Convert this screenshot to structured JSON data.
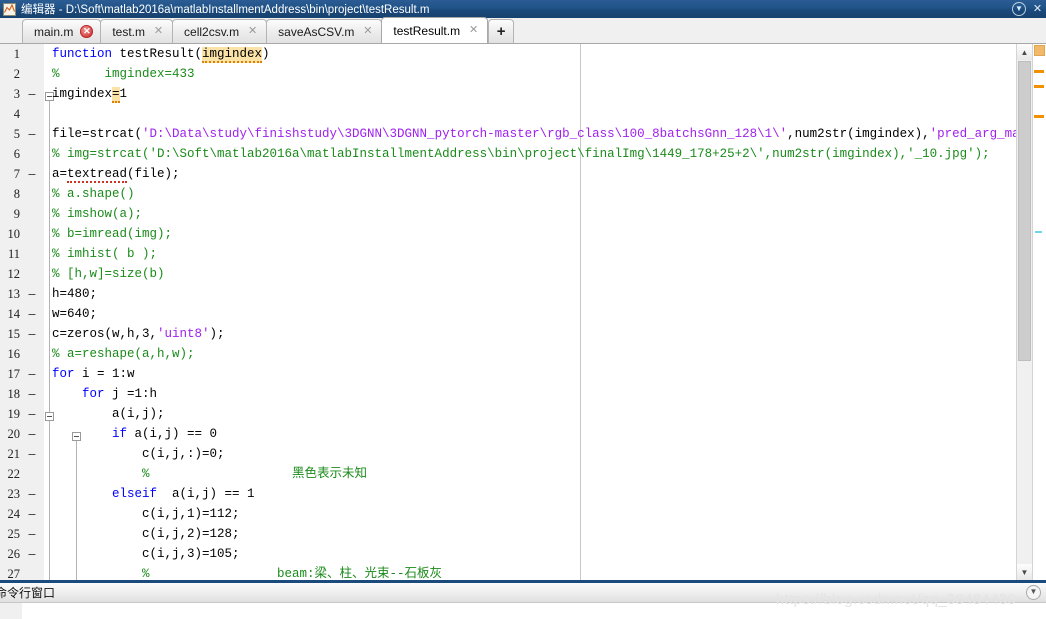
{
  "window": {
    "title": "编辑器 - D:\\Soft\\matlab2016a\\matlabInstallmentAddress\\bin\\project\\testResult.m",
    "icon": "matlab-editor-icon",
    "minimize_label": "▼",
    "close_label": "✕"
  },
  "tabs": {
    "items": [
      {
        "label": "main.m",
        "close": "✕",
        "dirty": true,
        "active": false
      },
      {
        "label": "test.m",
        "close": "✕",
        "dirty": false,
        "active": false
      },
      {
        "label": "cell2csv.m",
        "close": "✕",
        "dirty": false,
        "active": false
      },
      {
        "label": "saveAsCSV.m",
        "close": "✕",
        "dirty": false,
        "active": false
      },
      {
        "label": "testResult.m",
        "close": "✕",
        "dirty": false,
        "active": true
      }
    ],
    "add_label": "+"
  },
  "editor": {
    "lines": [
      {
        "num": "1",
        "dash": "",
        "html": "<span class=\"kw\">function</span> testResult(<span class=\"hl wavy\">imgindex</span>)"
      },
      {
        "num": "2",
        "dash": "",
        "html": "<span class=\"cmt\">%      imgindex=433</span>"
      },
      {
        "num": "3",
        "dash": "–",
        "html": "imgindex<span class=\"hl wavy\">=</span>1"
      },
      {
        "num": "4",
        "dash": "",
        "html": ""
      },
      {
        "num": "5",
        "dash": "–",
        "html": "file=strcat(<span class=\"str\">'D:\\Data\\study\\finishstudy\\3DGNN\\3DGNN_pytorch-master\\rgb_class\\100_8batchsGnn_128\\1\\'</span>,num2str(imgindex),<span class=\"str\">'pred_arg_max.txt'</span>);"
      },
      {
        "num": "6",
        "dash": "",
        "html": "<span class=\"cmt\">% img=strcat('D:\\Soft\\matlab2016a\\matlabInstallmentAddress\\bin\\project\\finalImg\\1449_178+25+2\\',num2str(imgindex),'_10.jpg');</span>"
      },
      {
        "num": "7",
        "dash": "–",
        "html": "a=<span class=\"wavy-red\">textread</span>(file);"
      },
      {
        "num": "8",
        "dash": "",
        "html": "<span class=\"cmt\">% a.shape()</span>"
      },
      {
        "num": "9",
        "dash": "",
        "html": "<span class=\"cmt\">% imshow(a);</span>"
      },
      {
        "num": "10",
        "dash": "",
        "html": "<span class=\"cmt\">% b=imread(img);</span>"
      },
      {
        "num": "11",
        "dash": "",
        "html": "<span class=\"cmt\">% imhist( b );</span>"
      },
      {
        "num": "12",
        "dash": "",
        "html": "<span class=\"cmt\">% [h,w]=size(b)</span>"
      },
      {
        "num": "13",
        "dash": "–",
        "html": "h=480;"
      },
      {
        "num": "14",
        "dash": "–",
        "html": "w=640;"
      },
      {
        "num": "15",
        "dash": "–",
        "html": "c=zeros(w,h,3,<span class=\"str\">'uint8'</span>);"
      },
      {
        "num": "16",
        "dash": "",
        "html": "<span class=\"cmt\">% a=reshape(a,h,w);</span>"
      },
      {
        "num": "17",
        "dash": "–",
        "html": "<span class=\"kw\">for</span> i = 1:w"
      },
      {
        "num": "18",
        "dash": "–",
        "html": "    <span class=\"kw\">for</span> j =1:h"
      },
      {
        "num": "19",
        "dash": "–",
        "html": "        a(i,j);"
      },
      {
        "num": "20",
        "dash": "–",
        "html": "        <span class=\"kw\">if</span> a(i,j) == 0"
      },
      {
        "num": "21",
        "dash": "–",
        "html": "            c(i,j,:)=0;"
      },
      {
        "num": "22",
        "dash": "",
        "html": "            <span class=\"cmt\">%                   黑色表示未知</span>"
      },
      {
        "num": "23",
        "dash": "–",
        "html": "        <span class=\"kw\">elseif</span>  a(i,j) == 1"
      },
      {
        "num": "24",
        "dash": "–",
        "html": "            c(i,j,1)=112;"
      },
      {
        "num": "25",
        "dash": "–",
        "html": "            c(i,j,2)=128;"
      },
      {
        "num": "26",
        "dash": "–",
        "html": "            c(i,j,3)=105;"
      },
      {
        "num": "27",
        "dash": "",
        "html": "            <span class=\"cmt\">%                 beam:梁、柱、光束--石板灰</span>"
      }
    ]
  },
  "scrollbar": {
    "up_arrow": "▲",
    "down_arrow": "▼"
  },
  "bottom_panel": {
    "title": "命令行窗口",
    "chevron": "▼"
  },
  "watermark": {
    "text": "https://blog.csdn.net/qq_38484430"
  },
  "colors": {
    "titlebar": "#1b4a7c",
    "keyword": "#0000ff",
    "comment": "#1a8b1a",
    "string": "#a020f0",
    "highlight": "#fbe3a8",
    "minimap_mark": "#f29000"
  }
}
